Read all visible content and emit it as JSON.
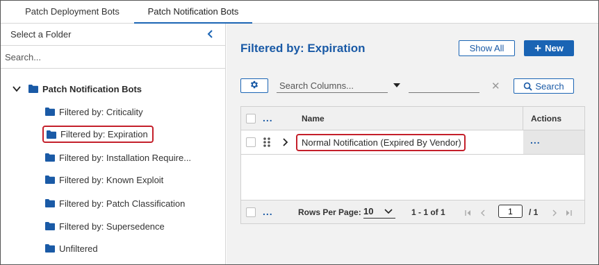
{
  "tabs": [
    {
      "label": "Patch Deployment Bots",
      "active": false
    },
    {
      "label": "Patch Notification Bots",
      "active": true
    }
  ],
  "sidebar": {
    "title": "Select a Folder",
    "collapse_icon": "chevron-left-icon",
    "search_placeholder": "Search...",
    "root": {
      "label": "Patch Notification Bots",
      "expanded": true,
      "icon": "folder-icon"
    },
    "items": [
      {
        "label": "Filtered by: Criticality",
        "selected": false
      },
      {
        "label": "Filtered by: Expiration",
        "selected": true
      },
      {
        "label": "Filtered by: Installation Require...",
        "selected": false
      },
      {
        "label": "Filtered by: Known Exploit",
        "selected": false
      },
      {
        "label": "Filtered by: Patch Classification",
        "selected": false
      },
      {
        "label": "Filtered by: Supersedence",
        "selected": false
      },
      {
        "label": "Unfiltered",
        "selected": false
      }
    ]
  },
  "main": {
    "title": "Filtered by: Expiration",
    "show_all_label": "Show All",
    "new_label": "New",
    "toolbar": {
      "settings_icon": "gear-icon",
      "column_search_placeholder": "Search Columns...",
      "value_field": "",
      "search_label": "Search"
    },
    "grid": {
      "columns": {
        "name": "Name",
        "actions": "Actions"
      },
      "more_icon": "...",
      "rows": [
        {
          "name": "Normal Notification (Expired By Vendor)",
          "actions": "..."
        }
      ],
      "footer": {
        "rows_per_page_label": "Rows Per Page:",
        "rows_per_page": "10",
        "range": "1 - 1 of 1",
        "page": "1",
        "total_pages": "/ 1"
      }
    }
  },
  "colors": {
    "accent": "#1a64b4",
    "title_blue": "#1a5aa6",
    "highlight": "#c41f2a",
    "main_bg": "#f2f2f2"
  }
}
